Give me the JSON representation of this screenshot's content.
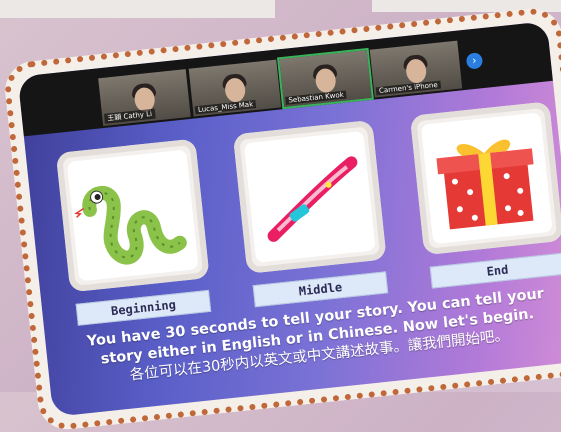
{
  "video_strip": {
    "participants": [
      {
        "name": "王穎 Cathy Li"
      },
      {
        "name": "Lucas_Miss Mak"
      },
      {
        "name": "Sebastian Kwok"
      },
      {
        "name": "Carmen's iPhone"
      }
    ],
    "next_page_icon": "chevron-right-icon"
  },
  "cards": [
    {
      "label": "Beginning",
      "icon": "snake-illustration"
    },
    {
      "label": "Middle",
      "icon": "slide-illustration"
    },
    {
      "label": "End",
      "icon": "gift-box-illustration"
    }
  ],
  "caption": {
    "line1": "You have 30 seconds to tell your story. You can tell your",
    "line2": "story either in English or in Chinese. Now let's begin.",
    "line3": "各位可以在30秒内以英文或中文講述故事。讓我們開始吧。"
  },
  "colors": {
    "frame_dots": "#c0683a",
    "slide_gradient_start": "#3f3f9a",
    "slide_gradient_end": "#d58fd6",
    "label_bg": "#dde9f8",
    "active_speaker": "#3bb35a"
  }
}
